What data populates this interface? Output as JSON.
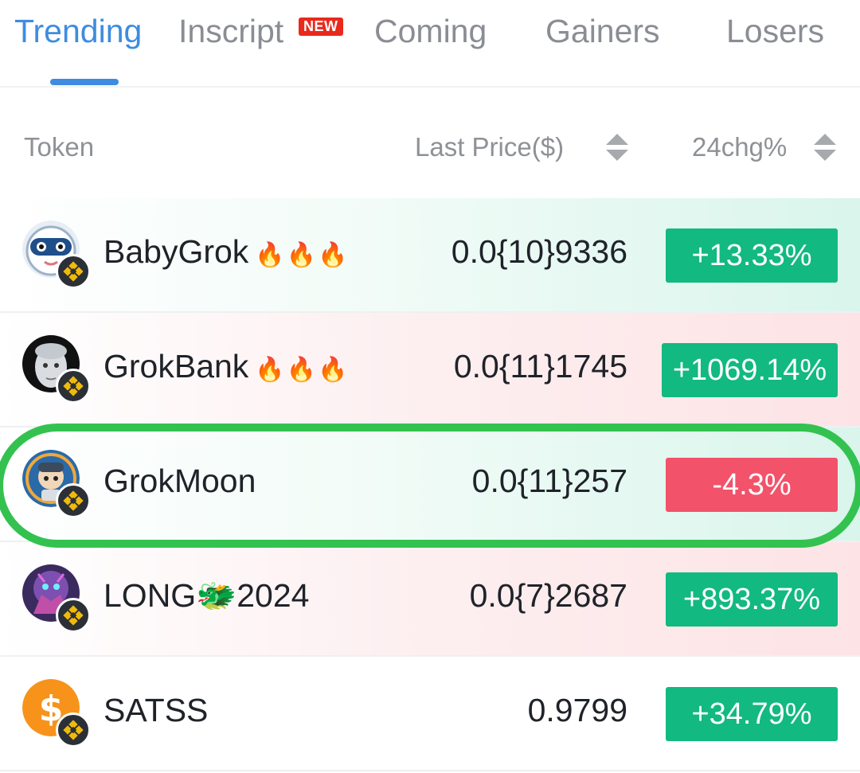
{
  "tabs": [
    {
      "label": "Trending",
      "active": true
    },
    {
      "label": "Inscript",
      "badge": "NEW"
    },
    {
      "label": "Coming"
    },
    {
      "label": "Gainers"
    },
    {
      "label": "Losers"
    }
  ],
  "columns": {
    "token": "Token",
    "price": "Last Price($)",
    "change": "24chg%"
  },
  "rows": [
    {
      "name": "BabyGrok",
      "fires": "🔥🔥🔥",
      "price": "0.0{10}9336",
      "change": "+13.33%",
      "direction": "up",
      "avatar": "astronaut-baby-icon"
    },
    {
      "name": "GrokBank",
      "fires": "🔥🔥🔥",
      "price": "0.0{11}1745",
      "change": "+1069.14%",
      "direction": "up",
      "avatar": "robot-face-icon"
    },
    {
      "name": "GrokMoon",
      "fires": "",
      "price": "0.0{11}257",
      "change": "-4.3%",
      "direction": "down",
      "avatar": "moon-astronaut-icon",
      "highlighted": true
    },
    {
      "name": "LONG🐲2024",
      "fires": "",
      "price": "0.0{7}2687",
      "change": "+893.37%",
      "direction": "up",
      "avatar": "dragon-icon"
    },
    {
      "name": "SATSS",
      "fires": "",
      "price": "0.9799",
      "change": "+34.79%",
      "direction": "up",
      "avatar": "dollar-coin-icon"
    }
  ],
  "colors": {
    "accent": "#3e8ce0",
    "up": "#12b981",
    "down": "#f2526a",
    "highlight": "#33c24f",
    "chain_badge": "#f0b90b"
  }
}
